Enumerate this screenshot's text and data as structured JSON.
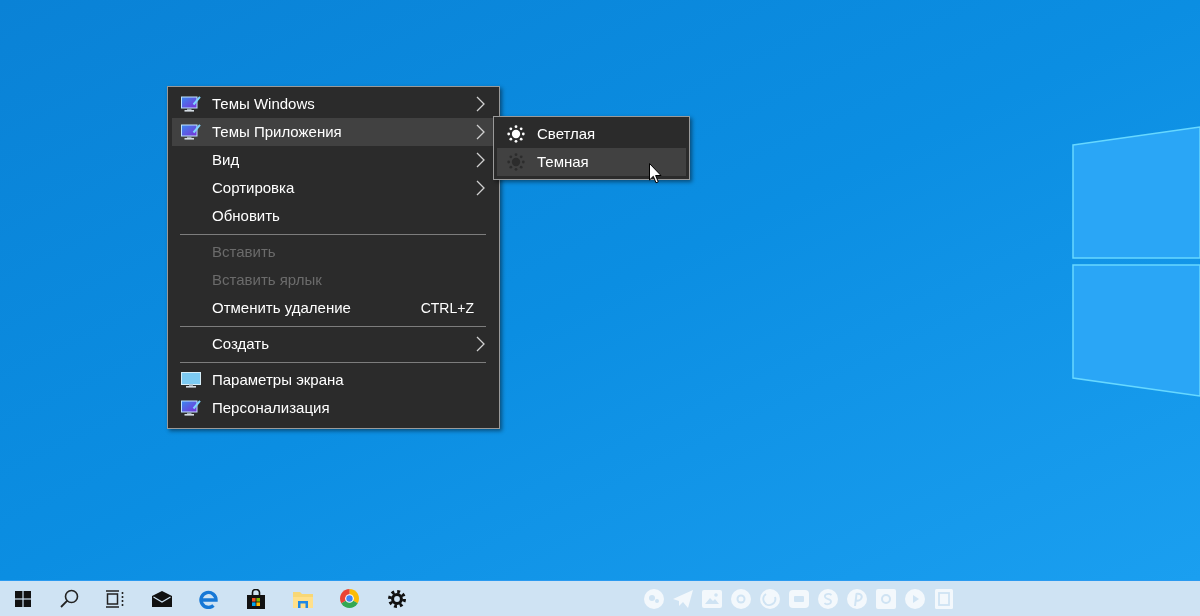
{
  "context_menu": {
    "groups": [
      {
        "items": [
          {
            "label": "Темы Windows",
            "kind": "personalize",
            "submenu": true,
            "disabled": false,
            "selected": false
          },
          {
            "label": "Темы Приложения",
            "kind": "personalize",
            "submenu": true,
            "disabled": false,
            "selected": true
          },
          {
            "label": "Вид",
            "kind": "plain",
            "submenu": true,
            "disabled": false,
            "selected": false
          },
          {
            "label": "Сортировка",
            "kind": "plain",
            "submenu": true,
            "disabled": false,
            "selected": false
          },
          {
            "label": "Обновить",
            "kind": "plain",
            "submenu": false,
            "disabled": false,
            "selected": false
          }
        ]
      },
      {
        "items": [
          {
            "label": "Вставить",
            "kind": "plain",
            "submenu": false,
            "disabled": true,
            "selected": false
          },
          {
            "label": "Вставить ярлык",
            "kind": "plain",
            "submenu": false,
            "disabled": true,
            "selected": false
          },
          {
            "label": "Отменить удаление",
            "kind": "plain",
            "submenu": false,
            "disabled": false,
            "selected": false,
            "shortcut": "CTRL+Z"
          }
        ]
      },
      {
        "items": [
          {
            "label": "Создать",
            "kind": "plain",
            "submenu": true,
            "disabled": false,
            "selected": false
          }
        ]
      },
      {
        "items": [
          {
            "label": "Параметры экрана",
            "kind": "display",
            "submenu": false,
            "disabled": false,
            "selected": false
          },
          {
            "label": "Персонализация",
            "kind": "personalize",
            "submenu": false,
            "disabled": false,
            "selected": false
          }
        ]
      }
    ]
  },
  "submenu": {
    "items": [
      {
        "label": "Светлая",
        "kind": "light",
        "selected": false
      },
      {
        "label": "Темная",
        "kind": "dark",
        "selected": true
      }
    ]
  }
}
